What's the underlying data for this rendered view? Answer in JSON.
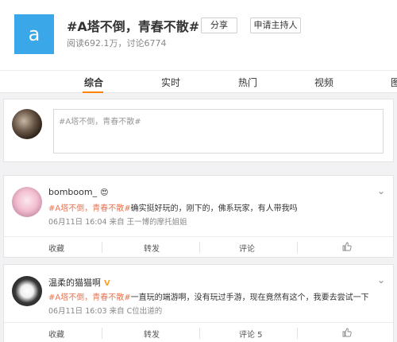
{
  "topic": {
    "avatar_letter": "a",
    "title": "#A塔不倒，青春不散#",
    "stats": "阅读692.1万，讨论6774",
    "share_label": "分享",
    "host_label": "申请主持人",
    "accent": "#3aa8e8"
  },
  "tabs": [
    {
      "label": "综合",
      "active": true
    },
    {
      "label": "实时"
    },
    {
      "label": "热门"
    },
    {
      "label": "视频"
    },
    {
      "label": "图"
    }
  ],
  "composer": {
    "placeholder": "#A塔不倒，青春不散#"
  },
  "posts": [
    {
      "name": "bomboom_",
      "badge": "😍",
      "tag": "#A塔不倒，青春不散#",
      "text": "确实挺好玩的，刚下的，佛系玩家，有人带我吗",
      "meta": "06月11日 16:04  来自 王一博的摩托姐姐",
      "actions": [
        "收藏",
        "转发",
        "评论"
      ]
    },
    {
      "name": "温柔的猫猫啊",
      "badge": "V",
      "tag": "#A塔不倒，青春不散#",
      "text": "一直玩的端游啊，没有玩过手游，现在竟然有这个，我要去尝试一下",
      "meta": "06月11日 16:03  来自 C位出道的",
      "actions": [
        "收藏",
        "转发",
        "评论 5"
      ]
    }
  ],
  "colors": {
    "tag": "#eb7350",
    "tab_underline": "#ff8200"
  }
}
